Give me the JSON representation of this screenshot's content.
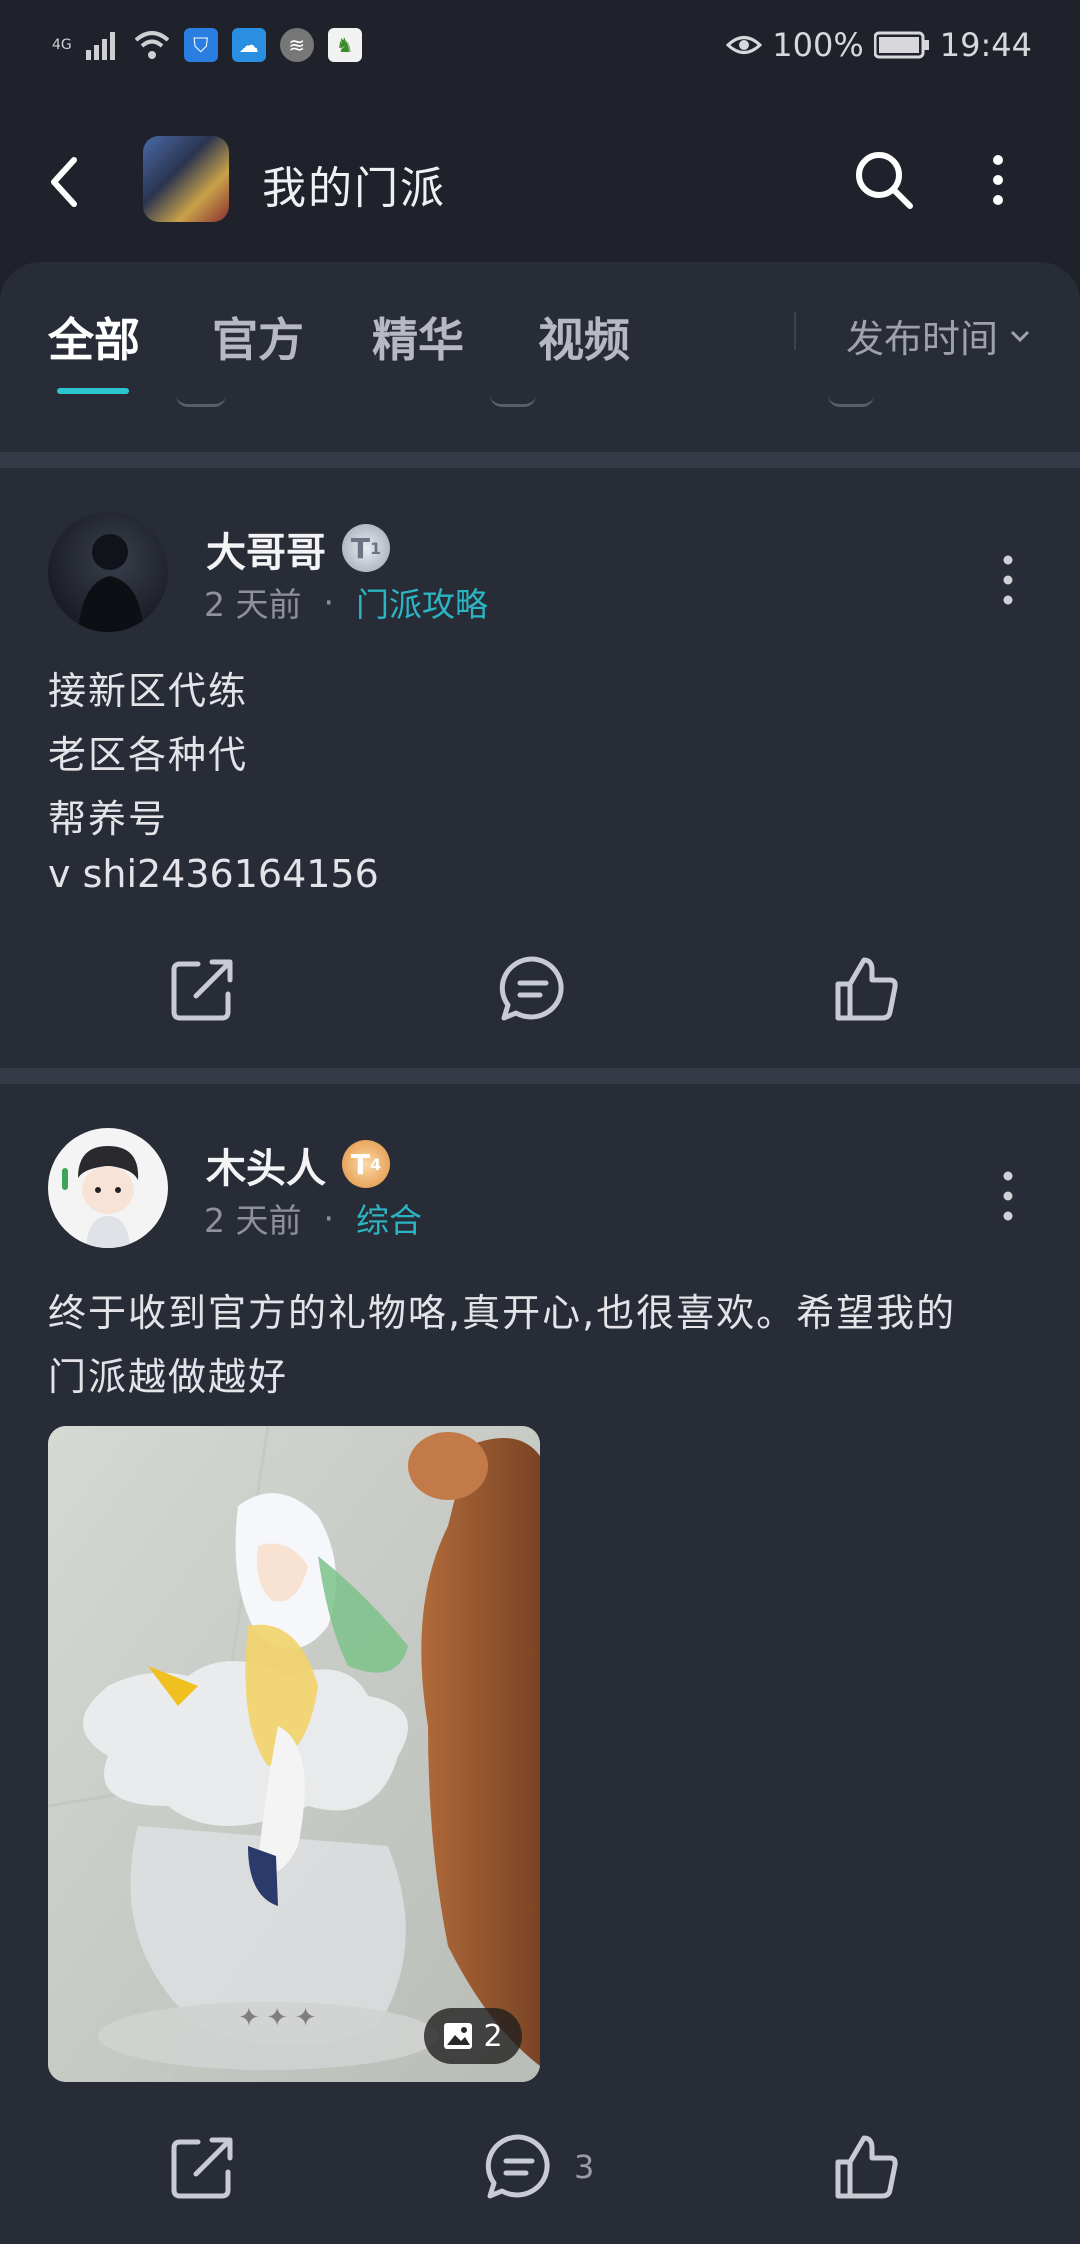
{
  "status_bar": {
    "network": "4G",
    "battery": "100%",
    "time": "19:44"
  },
  "header": {
    "title": "我的门派"
  },
  "tabs": [
    {
      "label": "全部",
      "active": true
    },
    {
      "label": "官方",
      "active": false
    },
    {
      "label": "精华",
      "active": false
    },
    {
      "label": "视频",
      "active": false
    }
  ],
  "sort": {
    "label": "发布时间"
  },
  "posts": [
    {
      "author": "大哥哥",
      "level": "T1",
      "time": "2 天前",
      "dot": "·",
      "category": "门派攻略",
      "lines": [
        "接新区代练",
        "老区各种代",
        "帮养号",
        "v  shi2436164156"
      ]
    },
    {
      "author": "木头人",
      "level": "T4",
      "time": "2 天前",
      "dot": "·",
      "category": "综合",
      "lines": [
        "终于收到官方的礼物咯,真开心,也很喜欢。希望我的",
        "门派越做越好"
      ],
      "image_count": "2",
      "comment_count": "3"
    }
  ],
  "colors": {
    "accent": "#2bc4cf",
    "background": "#1f222b",
    "card": "#282c37"
  }
}
